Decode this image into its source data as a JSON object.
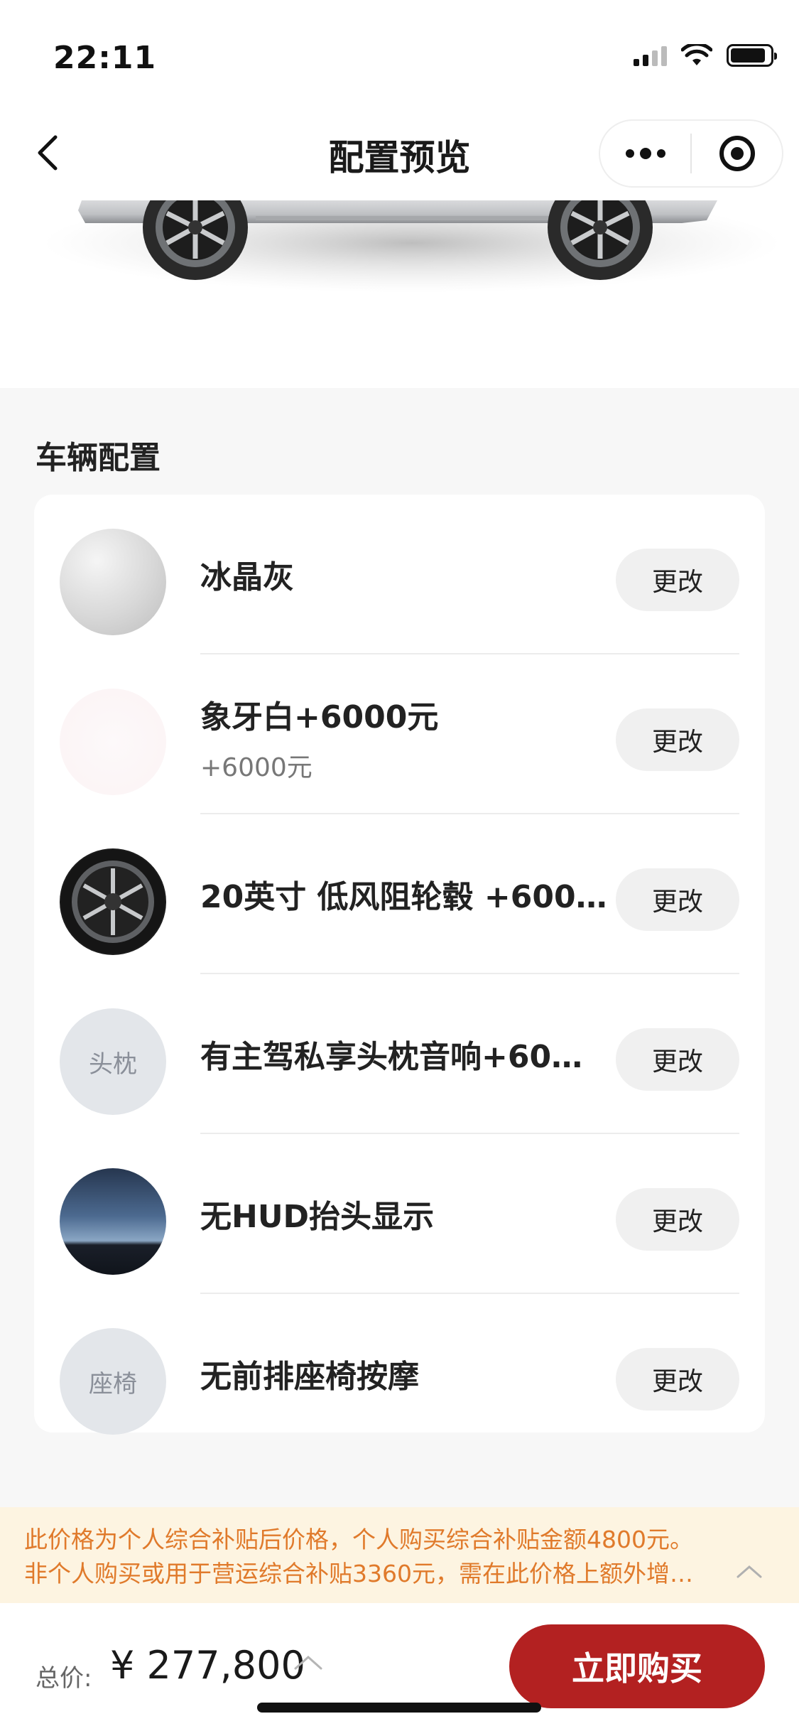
{
  "status_bar": {
    "time": "22:11"
  },
  "nav": {
    "title": "配置预览"
  },
  "section": {
    "title": "车辆配置"
  },
  "config_items": [
    {
      "title": "冰晶灰",
      "subtitle": "",
      "thumb_text": "",
      "button": "更改"
    },
    {
      "title": "象牙白+6000元",
      "subtitle": "+6000元",
      "thumb_text": "",
      "button": "更改"
    },
    {
      "title": "20英寸 低风阻轮毂 +600…",
      "subtitle": "",
      "thumb_text": "",
      "button": "更改"
    },
    {
      "title": "有主驾私享头枕音响+60…",
      "subtitle": "",
      "thumb_text": "头枕",
      "button": "更改"
    },
    {
      "title": "无HUD抬头显示",
      "subtitle": "",
      "thumb_text": "",
      "button": "更改"
    },
    {
      "title": "无前排座椅按摩",
      "subtitle": "",
      "thumb_text": "座椅",
      "button": "更改"
    }
  ],
  "notice": {
    "line1": "此价格为个人综合补贴后价格，个人购买综合补贴金额4800元。",
    "line2": "非个人购买或用于营运综合补贴3360元，需在此价格上额外增…"
  },
  "bottom": {
    "total_label": "总价:",
    "total_price": "¥ 277,800",
    "buy_label": "立即购买"
  },
  "colors": {
    "accent": "#b32121",
    "notice_text": "#e07a2b",
    "notice_bg": "#fdf4e1"
  }
}
